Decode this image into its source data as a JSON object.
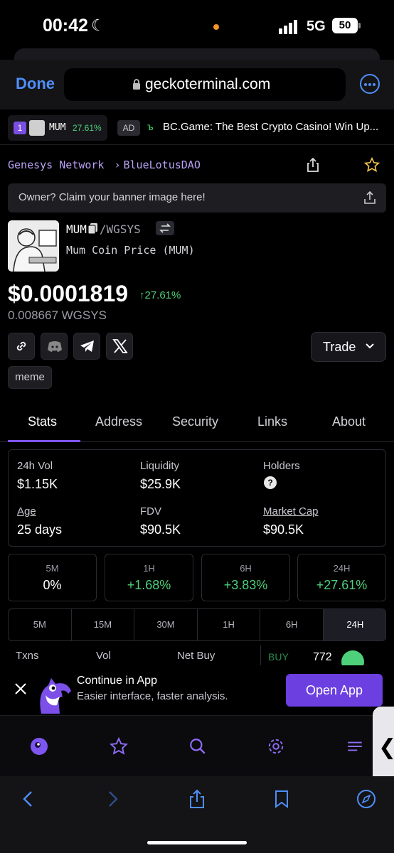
{
  "status_bar": {
    "time": "00:42",
    "network": "5G",
    "battery": "50"
  },
  "browser": {
    "done_label": "Done",
    "url": "geckoterminal.com"
  },
  "ticker": {
    "rank": "1",
    "symbol": "MUM",
    "change": "27.61%",
    "ad_badge": "AD",
    "ad_text": "BC.Game: The Best Crypto Casino! Win Up..."
  },
  "breadcrumb": {
    "network": "Genesys Network",
    "sep": "›",
    "dex": "BlueLotusDAO"
  },
  "banner": {
    "text": "Owner? Claim your banner image here!"
  },
  "token": {
    "symbol": "MUM",
    "pair": "/WGSYS",
    "description": "Mum Coin Price (MUM)",
    "price": "$0.0001819",
    "price_change": "27.61%",
    "price_native": "0.008667 WGSYS",
    "tag": "meme"
  },
  "trade_label": "Trade",
  "tabs": [
    "Stats",
    "Address",
    "Security",
    "Links",
    "About"
  ],
  "stats": {
    "vol_label": "24h Vol",
    "vol_value": "$1.15K",
    "liq_label": "Liquidity",
    "liq_value": "$25.9K",
    "holders_label": "Holders",
    "holders_value": "?",
    "age_label": "Age",
    "age_value": "25 days",
    "fdv_label": "FDV",
    "fdv_value": "$90.5K",
    "mcap_label": "Market Cap",
    "mcap_value": "$90.5K"
  },
  "intervals": [
    {
      "label": "5M",
      "value": "0%"
    },
    {
      "label": "1H",
      "value": "+1.68%"
    },
    {
      "label": "6H",
      "value": "+3.83%"
    },
    {
      "label": "24H",
      "value": "+27.61%"
    }
  ],
  "segments": [
    "5M",
    "15M",
    "30M",
    "1H",
    "6H",
    "24H"
  ],
  "txn_row": {
    "txns": "Txns",
    "vol": "Vol",
    "net_buy": "Net Buy",
    "buy": "BUY",
    "buy_count": "772"
  },
  "continue_app": {
    "title": "Continue in App",
    "subtitle": "Easier interface, faster analysis.",
    "button": "Open App"
  },
  "colors": {
    "accent": "#7d55f0",
    "positive": "#4ed07a",
    "link": "#4f8ef7",
    "crumb": "#b9a2f5"
  }
}
